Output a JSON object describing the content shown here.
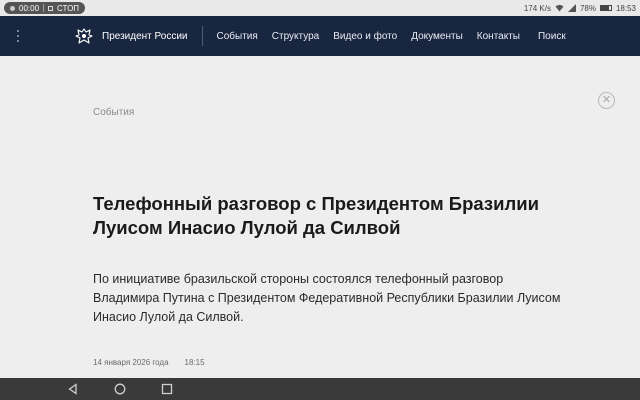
{
  "status_bar": {
    "rec_time": "00:00",
    "rec_stop": "СТОП",
    "net_speed": "174 K/s",
    "battery": "78%",
    "clock": "18:53"
  },
  "nav": {
    "brand": "Президент России",
    "links": [
      "События",
      "Структура",
      "Видео и фото",
      "Документы",
      "Контакты"
    ],
    "search": "Поиск"
  },
  "article": {
    "section": "События",
    "title": "Телефонный разговор с Президентом Бразилии Луисом Инасио Лулой да Силвой",
    "lead": "По инициативе бразильской стороны состоялся телефонный разговор Владимира Путина с Президентом Федеративной Республики Бразилии Луисом Инасио Лулой да Силвой.",
    "date": "14 января 2026 года",
    "time": "18:15"
  },
  "icons": {
    "close": "close-icon",
    "emblem": "emblem-icon",
    "menu": "menu-dots-icon"
  },
  "colors": {
    "nav_bg": "#182640",
    "page_bg": "#eeeeee"
  }
}
